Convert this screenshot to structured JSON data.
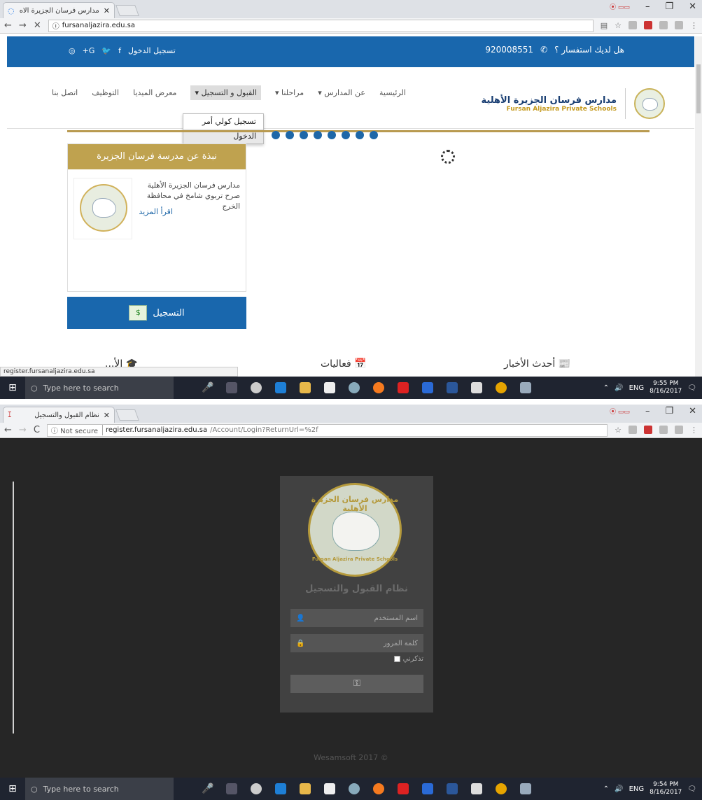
{
  "screenshot1": {
    "tab": {
      "title": "مدارس فرسان الجزيرة الاه"
    },
    "address": {
      "url": "fursanaljazira.edu.sa"
    },
    "topbar": {
      "login_link": "تسجيل الدخول",
      "phone_question": "هل لديك استفسار ؟",
      "phone": "920008551"
    },
    "brand": {
      "ar": "مدارس فرسان الجزيرة الأهلية",
      "en": "Fursan Aljazira Private Schools"
    },
    "menu": [
      "الرئيسية",
      "عن المدارس ▾",
      "مراحلنا ▾",
      "القبول و التسجيل ▾",
      "معرض الميديا",
      "التوظيف",
      "اتصل بنا"
    ],
    "dropdown": [
      "تسجيل كولي أمر",
      "الدخول"
    ],
    "about": {
      "heading": "نبذة عن مدرسة فرسان الجزيرة",
      "text": "مدارس فرسان الجزيرة الأهلية صرح تربوي شامخ في محافظة الخرج",
      "more": "اقرأ المزيد"
    },
    "register_button": "التسجيل",
    "sections": {
      "news": "أحدث الأخبار",
      "events": "فعاليات",
      "third": "الأ..."
    },
    "status_url": "register.fursanaljazira.edu.sa",
    "taskbar": {
      "search": "Type here to search",
      "lang": "ENG",
      "time": "9:55 PM",
      "date": "8/16/2017"
    }
  },
  "screenshot2": {
    "tab": {
      "title": "نظام القبول والتسجيل"
    },
    "address": {
      "not_secure": "Not secure",
      "host": "register.fursanaljazira.edu.sa",
      "path": "/Account/Login?ReturnUrl=%2f"
    },
    "login": {
      "logo_text": "مدارس فرسان الجزيرة الأهلية",
      "logo_en": "Fursan Aljazira Private Schools",
      "system_title": "نظام القبول والتسجيل",
      "username_placeholder": "اسم المستخدم",
      "password_placeholder": "كلمة المرور",
      "remember": "تذكرني",
      "footer": "Wesamsoft 2017 ©"
    },
    "taskbar": {
      "search": "Type here to search",
      "lang": "ENG",
      "time": "9:54 PM",
      "date": "8/16/2017"
    }
  },
  "icons": {
    "close": "close-icon",
    "back": "back-arrow-icon",
    "forward": "forward-arrow-icon",
    "reload": "reload-icon",
    "info": "info-icon",
    "star": "star-icon",
    "user": "user-icon",
    "lock": "lock-icon",
    "key": "key-icon",
    "phone": "phone-icon",
    "calendar": "calendar-icon",
    "newspaper": "newspaper-icon"
  },
  "colors": {
    "site_blue": "#1967ad",
    "gold": "#bfa24f",
    "login_bg": "#262626",
    "login_box": "#414141"
  }
}
